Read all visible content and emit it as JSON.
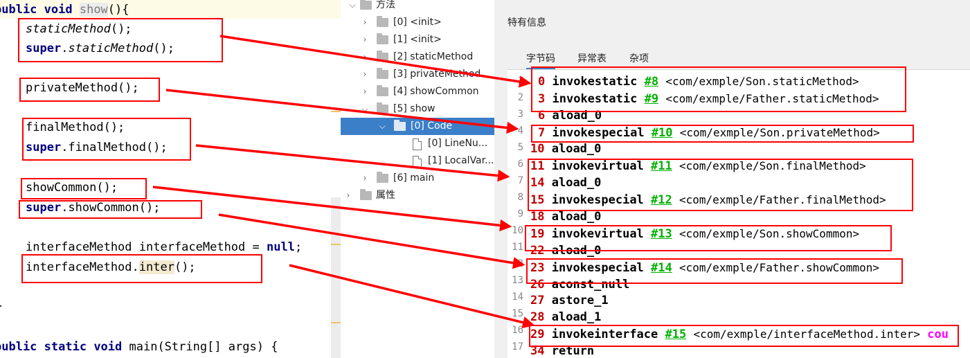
{
  "code": {
    "line0": {
      "kw1": "public",
      "kw2": " void ",
      "name": "show",
      "rest": "(){"
    },
    "line1": {
      "call": "staticMethod",
      "rest": "();"
    },
    "line2": {
      "kw": "super",
      "dot": ".",
      "call": "staticMethod",
      "rest": "();"
    },
    "line3": {
      "text": "privateMethod();"
    },
    "line4": {
      "text": "finalMethod();"
    },
    "line5": {
      "kw": "super",
      "rest": ".finalMethod();"
    },
    "line6": {
      "text": "showCommon();"
    },
    "line7": {
      "kw": "super",
      "rest": ".showCommon();"
    },
    "line8": {
      "pre": "interfaceMethod interfaceMethod = ",
      "kw": "null",
      "post": ";"
    },
    "line9": {
      "pre": "interfaceMethod.",
      "hl": "inter",
      "post": "();"
    },
    "line10": {
      "text": "}"
    },
    "line11": {
      "kw1": "public",
      "kw2": " static",
      "kw3": " void",
      "rest": " main(String[] args) {"
    }
  },
  "tree": {
    "methods": "方法",
    "items": [
      "[0] <init>",
      "[1] <init>",
      "[2] staticMethod",
      "[3] privateMethod",
      "[4] showCommon",
      "[5] show"
    ],
    "code": "[0] Code",
    "lineNumbers": "[0] LineNu...",
    "localVars": "[1] LocalVar...",
    "main": "[6] main",
    "attributes": "属性"
  },
  "info": {
    "title": "特有信息",
    "tabs": [
      "字节码",
      "异常表",
      "杂项"
    ]
  },
  "bytecode": {
    "lineNumbers": [
      "1",
      "2",
      "3",
      "4",
      "5",
      "6",
      "7",
      "8",
      "9",
      "10",
      "11",
      "12",
      "13",
      "14",
      "15",
      "16",
      "17"
    ],
    "rows": [
      {
        "off": "0",
        "op": "invokestatic",
        "ref": "#8",
        "target": "<com/exmple/Son.staticMethod>"
      },
      {
        "off": "3",
        "op": "invokestatic",
        "ref": "#9",
        "target": "<com/exmple/Father.staticMethod>"
      },
      {
        "off": "6",
        "op": "aload_0"
      },
      {
        "off": "7",
        "op": "invokespecial",
        "ref": "#10",
        "target": "<com/exmple/Son.privateMethod>"
      },
      {
        "off": "10",
        "op": "aload_0"
      },
      {
        "off": "11",
        "op": "invokevirtual",
        "ref": "#11",
        "target": "<com/exmple/Son.finalMethod>"
      },
      {
        "off": "14",
        "op": "aload_0"
      },
      {
        "off": "15",
        "op": "invokespecial",
        "ref": "#12",
        "target": "<com/exmple/Father.finalMethod>"
      },
      {
        "off": "18",
        "op": "aload_0"
      },
      {
        "off": "19",
        "op": "invokevirtual",
        "ref": "#13",
        "target": "<com/exmple/Son.showCommon>"
      },
      {
        "off": "22",
        "op": "aload_0"
      },
      {
        "off": "23",
        "op": "invokespecial",
        "ref": "#14",
        "target": "<com/exmple/Father.showCommon>"
      },
      {
        "off": "26",
        "op": "aconst_null"
      },
      {
        "off": "27",
        "op": "astore_1"
      },
      {
        "off": "28",
        "op": "aload_1"
      },
      {
        "off": "29",
        "op": "invokeinterface",
        "ref": "#15",
        "target": "<com/exmple/interfaceMethod.inter>",
        "extra": "cou"
      },
      {
        "off": "34",
        "op": "return"
      }
    ]
  },
  "colors": {
    "annotation": "#ff0000",
    "selection": "#3c7fc9",
    "keyword": "#000080",
    "offset": "#c00000",
    "constRef": "#00b000"
  }
}
